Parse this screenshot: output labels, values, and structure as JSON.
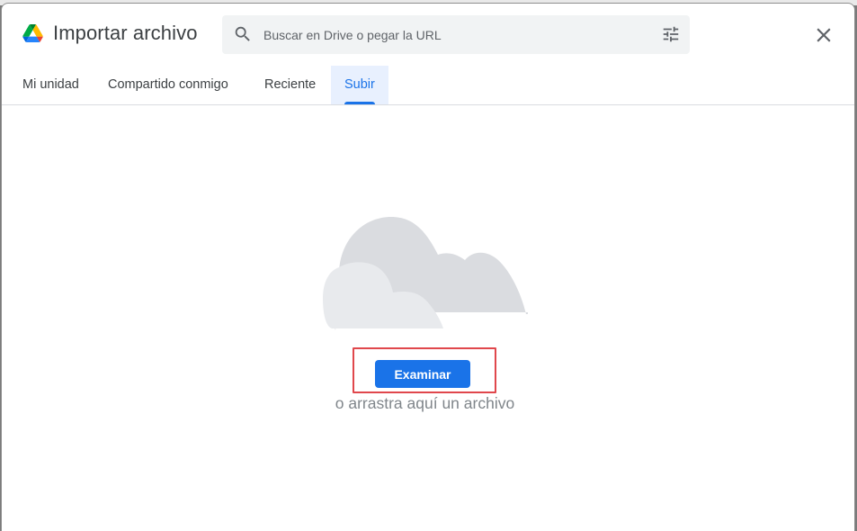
{
  "dialog": {
    "title": "Importar archivo",
    "logo_icon": "google-drive-logo",
    "close_icon": "close-icon"
  },
  "search": {
    "placeholder": "Buscar en Drive o pegar la URL",
    "value": "",
    "search_icon": "search-icon",
    "options_icon": "tune-icon"
  },
  "tabs": [
    {
      "label": "Mi unidad",
      "active": false
    },
    {
      "label": "Compartido conmigo",
      "active": false
    },
    {
      "label": "Reciente",
      "active": false
    },
    {
      "label": "Subir",
      "active": true
    }
  ],
  "upload": {
    "illustration_icon": "cloud-icon",
    "browse_label": "Examinar",
    "drag_hint": "o arrastra aquí un archivo",
    "highlighted": true
  },
  "colors": {
    "accent": "#1a73e8",
    "active_tab_bg": "#e8f0fe",
    "highlight": "#e0474c",
    "search_bg": "#f1f3f4",
    "cloud_back": "#dadce0",
    "cloud_front": "#e8eaed"
  }
}
